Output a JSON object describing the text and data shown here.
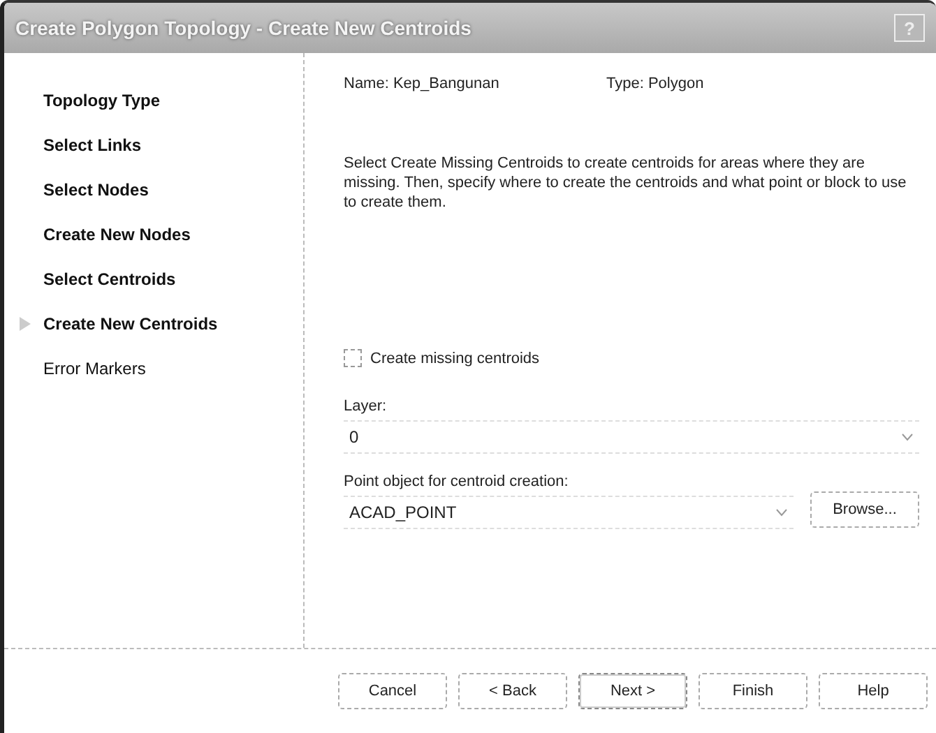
{
  "window": {
    "title": "Create Polygon Topology - Create New Centroids",
    "help_button": "?"
  },
  "steps": [
    {
      "label": "Topology Type",
      "visited": true,
      "selected": false
    },
    {
      "label": "Select Links",
      "visited": true,
      "selected": false
    },
    {
      "label": "Select Nodes",
      "visited": true,
      "selected": false
    },
    {
      "label": "Create New Nodes",
      "visited": true,
      "selected": false
    },
    {
      "label": "Select Centroids",
      "visited": true,
      "selected": false
    },
    {
      "label": "Create New Centroids",
      "visited": true,
      "selected": true
    },
    {
      "label": "Error Markers",
      "visited": false,
      "selected": false
    }
  ],
  "info": {
    "name": "Name: Kep_Bangunan",
    "type": "Type: Polygon"
  },
  "description": "Select Create Missing Centroids to create centroids for areas where they are missing. Then, specify where to create the centroids and what point or block to use to create them.",
  "create_missing": {
    "label": "Create missing centroids",
    "checked": false
  },
  "layer": {
    "label": "Layer:",
    "value": "0"
  },
  "point_object": {
    "label": "Point object for centroid creation:",
    "value": "ACAD_POINT",
    "browse": "Browse..."
  },
  "buttons": [
    {
      "label": "Cancel",
      "focused": false
    },
    {
      "label": "< Back",
      "focused": false
    },
    {
      "label": "Next >",
      "focused": true
    },
    {
      "label": "Finish",
      "focused": false
    },
    {
      "label": "Help",
      "focused": false
    }
  ]
}
